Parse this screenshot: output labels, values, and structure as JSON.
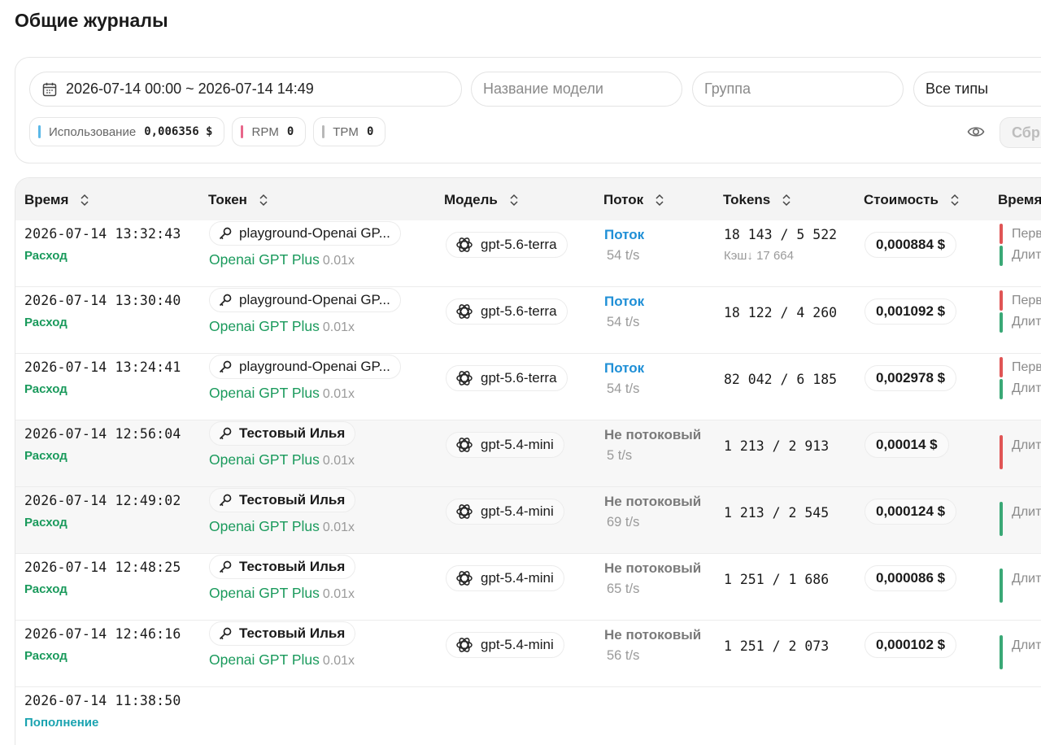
{
  "page": {
    "title": "Общие журналы"
  },
  "filters": {
    "date_range": "2026-07-14 00:00 ~ 2026-07-14 14:49",
    "model_placeholder": "Название модели",
    "group_placeholder": "Группа",
    "type_value": "Все типы"
  },
  "stats": {
    "usage_label": "Использование",
    "usage_value": "0,006356 $",
    "rpm_label": "RPM",
    "rpm_value": "0",
    "tpm_label": "TPM",
    "tpm_value": "0"
  },
  "actions": {
    "reset_label": "Сбр"
  },
  "table": {
    "headers": {
      "time": "Время",
      "token": "Токен",
      "model": "Модель",
      "stream": "Поток",
      "tokens": "Tokens",
      "cost": "Стоимость",
      "timing": "Время"
    },
    "rows": [
      {
        "time": "2026-07-14 13:32:43",
        "type": "Расход",
        "token": "playground-Openai GP...",
        "group": "Openai GPT Plus",
        "ratio": "0.01x",
        "model": "gpt-5.6-terra",
        "stream": "Поток",
        "speed": "54 t/s",
        "tokens": "18 143 / 5 522",
        "cache": "Кэш↓ 17 664",
        "cost": "0,000884 $",
        "timing_top": "Перв",
        "timing_bottom": "Длит"
      },
      {
        "time": "2026-07-14 13:30:40",
        "type": "Расход",
        "token": "playground-Openai GP...",
        "group": "Openai GPT Plus",
        "ratio": "0.01x",
        "model": "gpt-5.6-terra",
        "stream": "Поток",
        "speed": "54 t/s",
        "tokens": "18 122 / 4 260",
        "cost": "0,001092 $",
        "timing_top": "Перв",
        "timing_bottom": "Длит"
      },
      {
        "time": "2026-07-14 13:24:41",
        "type": "Расход",
        "token": "playground-Openai GP...",
        "group": "Openai GPT Plus",
        "ratio": "0.01x",
        "model": "gpt-5.6-terra",
        "stream": "Поток",
        "speed": "54 t/s",
        "tokens": "82 042 / 6 185",
        "cost": "0,002978 $",
        "timing_top": "Перв",
        "timing_bottom": "Длит"
      },
      {
        "time": "2026-07-14 12:56:04",
        "type": "Расход",
        "token": "Тестовый Илья",
        "group": "Openai GPT Plus",
        "ratio": "0.01x",
        "model": "gpt-5.4-mini",
        "stream": "Не потоковый",
        "speed": "5 t/s",
        "tokens": "1 213 / 2 913",
        "cost": "0,00014 $",
        "timing_single": "Длит"
      },
      {
        "time": "2026-07-14 12:49:02",
        "type": "Расход",
        "token": "Тестовый Илья",
        "group": "Openai GPT Plus",
        "ratio": "0.01x",
        "model": "gpt-5.4-mini",
        "stream": "Не потоковый",
        "speed": "69 t/s",
        "tokens": "1 213 / 2 545",
        "cost": "0,000124 $",
        "timing_single": "Длит"
      },
      {
        "time": "2026-07-14 12:48:25",
        "type": "Расход",
        "token": "Тестовый Илья",
        "group": "Openai GPT Plus",
        "ratio": "0.01x",
        "model": "gpt-5.4-mini",
        "stream": "Не потоковый",
        "speed": "65 t/s",
        "tokens": "1 251 / 1 686",
        "cost": "0,000086 $",
        "timing_single": "Длит"
      },
      {
        "time": "2026-07-14 12:46:16",
        "type": "Расход",
        "token": "Тестовый Илья",
        "group": "Openai GPT Plus",
        "ratio": "0.01x",
        "model": "gpt-5.4-mini",
        "stream": "Не потоковый",
        "speed": "56 t/s",
        "tokens": "1 251 / 2 073",
        "cost": "0,000102 $",
        "timing_single": "Длит"
      },
      {
        "time": "2026-07-14 11:38:50",
        "type": "Пополнение"
      }
    ]
  },
  "colors": {
    "expense": "#1a9a5c",
    "topup": "#1aa3b0",
    "stream": "#1f8fd6",
    "nonstream": "#7a7a7a",
    "bar_red": "#e05555",
    "bar_green": "#3aa876",
    "usage_bar": "#5bb8e8",
    "rpm_bar": "#e8668a",
    "tpm_bar": "#b8b8b8"
  }
}
